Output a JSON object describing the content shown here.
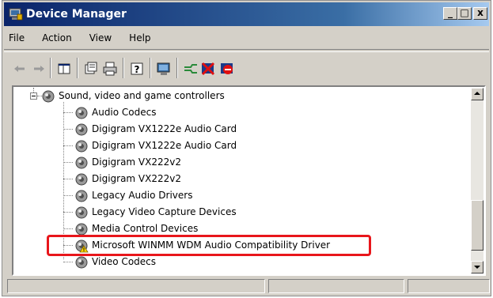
{
  "window": {
    "title": "Device Manager",
    "controls": {
      "minimize": "_",
      "maximize": "□",
      "close": "x"
    }
  },
  "menu": {
    "items": [
      "File",
      "Action",
      "View",
      "Help"
    ]
  },
  "toolbar": {
    "buttons": [
      {
        "name": "back-arrow-icon"
      },
      {
        "name": "forward-arrow-icon"
      },
      {
        "name": "show-hide-console-tree-icon"
      },
      {
        "name": "properties-icon"
      },
      {
        "name": "print-icon"
      },
      {
        "name": "help-icon"
      },
      {
        "name": "scan-hardware-icon"
      },
      {
        "name": "update-driver-icon"
      },
      {
        "name": "uninstall-icon"
      },
      {
        "name": "disable-icon"
      }
    ]
  },
  "tree": {
    "category": "Sound, video and game controllers",
    "items": [
      {
        "label": "Audio Codecs",
        "warning": false
      },
      {
        "label": "Digigram VX1222e Audio Card",
        "warning": false
      },
      {
        "label": "Digigram VX1222e Audio Card",
        "warning": false
      },
      {
        "label": "Digigram VX222v2",
        "warning": false
      },
      {
        "label": "Digigram VX222v2",
        "warning": false
      },
      {
        "label": "Legacy Audio Drivers",
        "warning": false
      },
      {
        "label": "Legacy Video Capture Devices",
        "warning": false
      },
      {
        "label": "Media Control Devices",
        "warning": false
      },
      {
        "label": "Microsoft WINMM WDM Audio Compatibility Driver",
        "warning": true
      },
      {
        "label": "Video Codecs",
        "warning": false
      }
    ]
  },
  "colors": {
    "highlight_outline": "#e8161b",
    "titlebar_start": "#0a246a",
    "titlebar_end": "#a6caf0"
  }
}
